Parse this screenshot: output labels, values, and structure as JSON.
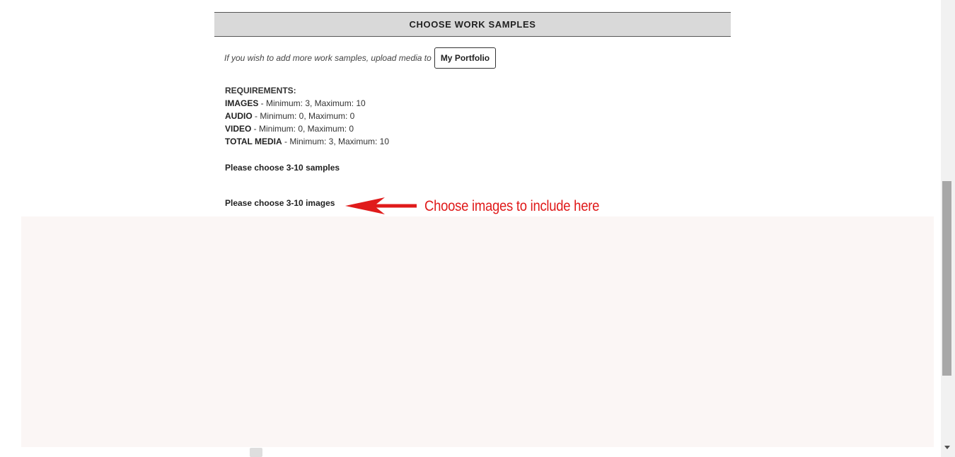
{
  "section": {
    "title": "CHOOSE WORK SAMPLES"
  },
  "upload": {
    "text": "If you wish to add more work samples, upload media to",
    "button_label": "My Portfolio"
  },
  "requirements": {
    "heading": "REQUIREMENTS:",
    "items": [
      {
        "label": "IMAGES",
        "text": " - Minimum: 3, Maximum: 10"
      },
      {
        "label": "AUDIO",
        "text": " - Minimum: 0, Maximum: 0"
      },
      {
        "label": "VIDEO",
        "text": " - Minimum: 0, Maximum: 0"
      },
      {
        "label": "TOTAL MEDIA",
        "text": " - Minimum: 3, Maximum: 10"
      }
    ]
  },
  "prompts": {
    "samples": "Please choose 3-10 samples",
    "images": "Please choose 3-10 images"
  },
  "annotation": {
    "text": "Choose images to include here",
    "color": "#e01b1b"
  },
  "colors": {
    "header_bg": "#d9d9d9",
    "media_area_bg": "#fbf6f5"
  }
}
